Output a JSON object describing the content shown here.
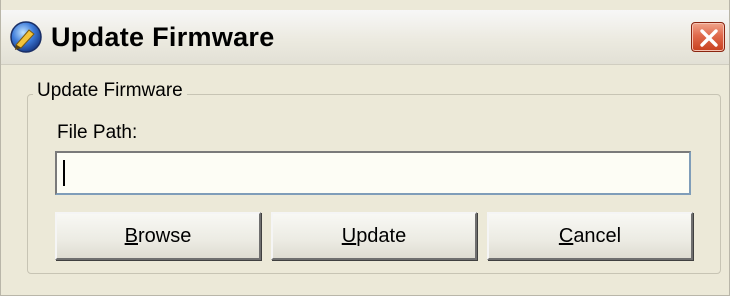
{
  "window": {
    "title": "Update Firmware",
    "app_icon": "firmware-app-icon",
    "close_icon": "close-icon"
  },
  "group": {
    "legend": "Update Firmware",
    "file_path_label": "File Path:",
    "file_path_value": "",
    "file_path_placeholder": ""
  },
  "buttons": {
    "browse": {
      "mnemonic": "B",
      "rest": "rowse"
    },
    "update": {
      "mnemonic": "U",
      "rest": "pdate"
    },
    "cancel": {
      "mnemonic": "C",
      "rest": "ancel"
    }
  },
  "colors": {
    "dialog_bg": "#ece9d8",
    "close_button": "#d9532f",
    "input_border": "#7f9db9"
  }
}
